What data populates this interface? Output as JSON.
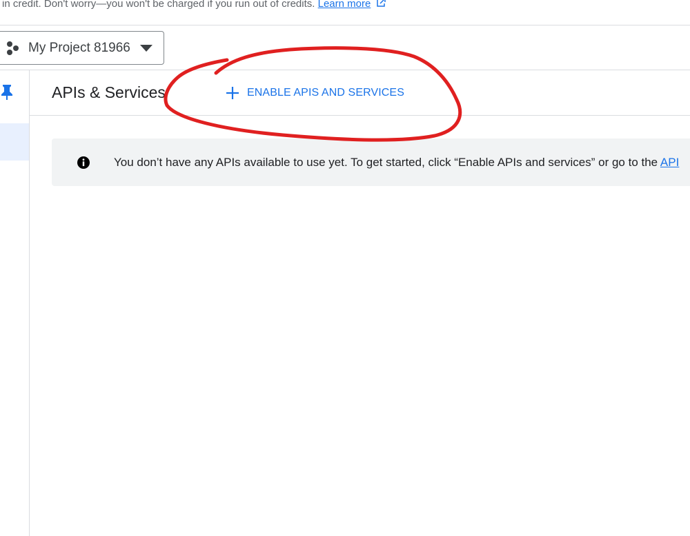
{
  "banner": {
    "text": "in credit. Don't worry—you won't be charged if you run out of credits.",
    "link_label": "Learn more",
    "link_icon": "external-link-icon"
  },
  "project_picker": {
    "icon": "project-hub-icon",
    "name": "My Project 81966",
    "caret": "dropdown-arrow-icon"
  },
  "left_rail": {
    "pin_icon": "pin-icon"
  },
  "header": {
    "title": "APIs & Services",
    "enable_button_label": "ENABLE APIS AND SERVICES",
    "enable_button_icon": "plus-icon"
  },
  "info_banner": {
    "icon": "info-icon",
    "message": "You don’t have any APIs available to use yet. To get started, click “Enable APIs and services” or go to the ",
    "link_label": "API"
  },
  "colors": {
    "accent": "#1a73e8",
    "annotation": "#e02020",
    "banner_bg": "#f1f3f4",
    "border": "#dadce0"
  }
}
